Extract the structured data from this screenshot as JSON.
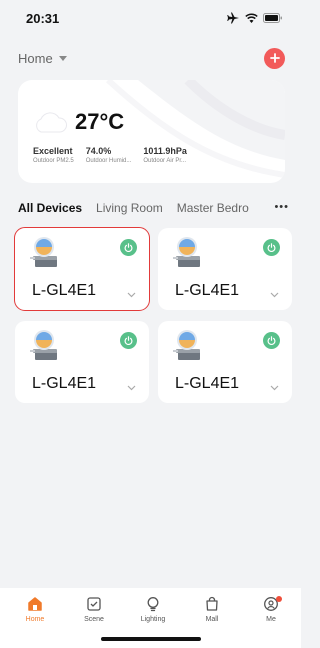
{
  "status_bar": {
    "time": "20:31"
  },
  "header": {
    "home_label": "Home"
  },
  "weather": {
    "temperature": "27°C",
    "stats": [
      {
        "value": "Excellent",
        "label": "Outdoor PM2.5"
      },
      {
        "value": "74.0%",
        "label": "Outdoor Humid..."
      },
      {
        "value": "1011.9hPa",
        "label": "Outdoor Air Pr..."
      }
    ]
  },
  "rooms": {
    "tabs": [
      "All Devices",
      "Living Room",
      "Master Bedro"
    ],
    "more": "•••"
  },
  "devices": [
    {
      "name": "L-GL4E1",
      "selected": true
    },
    {
      "name": "L-GL4E1",
      "selected": false
    },
    {
      "name": "L-GL4E1",
      "selected": false
    },
    {
      "name": "L-GL4E1",
      "selected": false
    }
  ],
  "tab_bar": {
    "items": [
      {
        "label": "Home",
        "icon": "home-icon",
        "active": true
      },
      {
        "label": "Scene",
        "icon": "scene-icon",
        "active": false
      },
      {
        "label": "Lighting",
        "icon": "lighting-icon",
        "active": false
      },
      {
        "label": "Mall",
        "icon": "mall-icon",
        "active": false
      },
      {
        "label": "Me",
        "icon": "me-icon",
        "active": false
      }
    ]
  },
  "colors": {
    "accent": "#f07a2a",
    "power": "#58c08a",
    "add": "#f25a5a",
    "selection": "#e23a3a"
  }
}
